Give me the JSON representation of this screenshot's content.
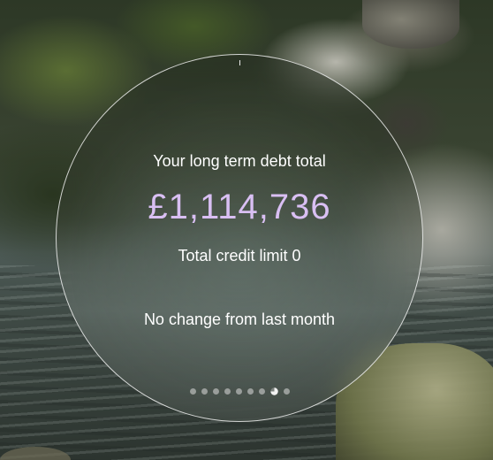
{
  "card": {
    "title": "Your long term debt total",
    "amount": "£1,114,736",
    "credit_limit_text": "Total credit limit 0",
    "change_text": "No change from last month"
  },
  "pagination": {
    "total": 9,
    "active_index": 7
  },
  "colors": {
    "amount": "#d9bff3",
    "text": "#ffffff",
    "card_border": "#ffffff"
  }
}
